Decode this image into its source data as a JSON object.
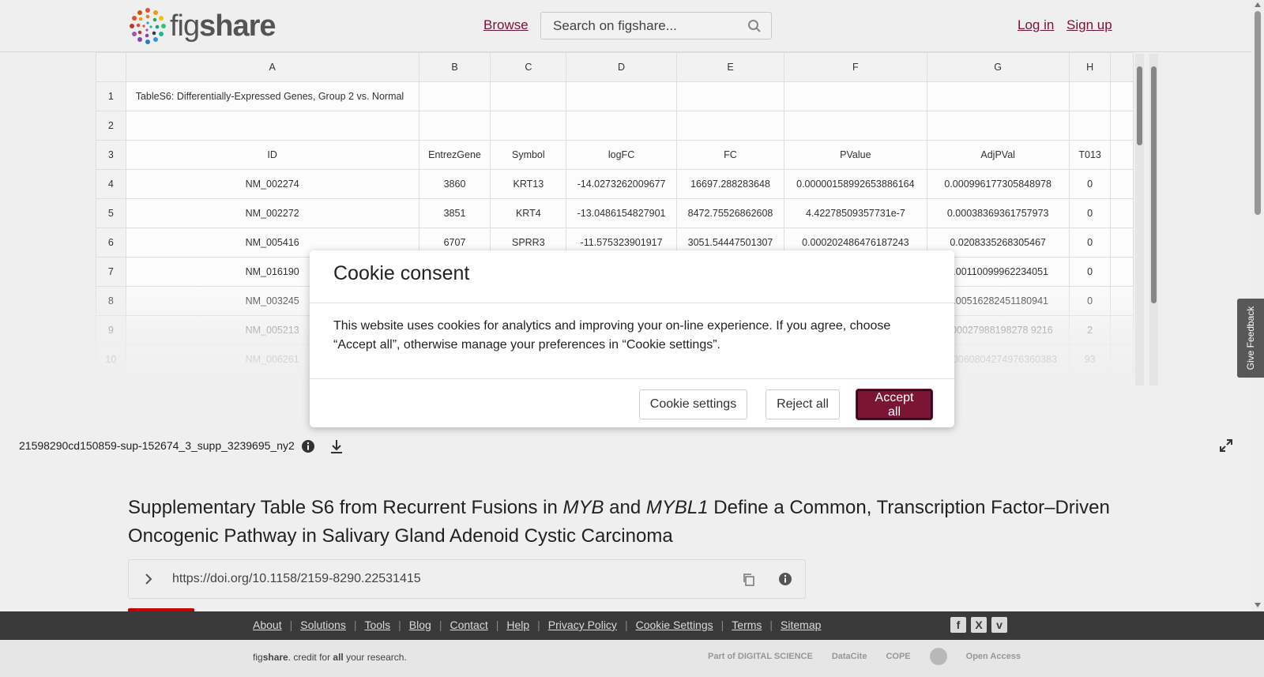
{
  "header": {
    "logo_text_light": "fig",
    "logo_text_bold": "share",
    "browse_label": "Browse",
    "search_placeholder": "Search on figshare...",
    "login_label": "Log in",
    "signup_label": "Sign up"
  },
  "sheet": {
    "columns": [
      "A",
      "B",
      "C",
      "D",
      "E",
      "F",
      "G",
      "H"
    ],
    "rows": [
      {
        "num": "1",
        "cells": [
          "TableS6: Differentially-Expressed Genes, Group 2 vs. Normal",
          "",
          "",
          "",
          "",
          "",
          "",
          ""
        ]
      },
      {
        "num": "2",
        "cells": [
          "",
          "",
          "",
          "",
          "",
          "",
          "",
          ""
        ]
      },
      {
        "num": "3",
        "cells": [
          "ID",
          "EntrezGene",
          "Symbol",
          "logFC",
          "FC",
          "PValue",
          "AdjPVal",
          "T013"
        ]
      },
      {
        "num": "4",
        "cells": [
          "NM_002274",
          "3860",
          "KRT13",
          "-14.0273262009677",
          "16697.288283648",
          "0.00000158992653886164",
          "0.000996177305848978",
          "0"
        ]
      },
      {
        "num": "5",
        "cells": [
          "NM_002272",
          "3851",
          "KRT4",
          "-13.0486154827901",
          "8472.75526862608",
          "4.42278509357731e-7",
          "0.00038369361757973",
          "0"
        ]
      },
      {
        "num": "6",
        "cells": [
          "NM_005416",
          "6707",
          "SPRR3",
          "-11.575323901917",
          "3051.54447501307",
          "0.000202486476187243",
          "0.0208335268305467",
          "0"
        ]
      },
      {
        "num": "7",
        "cells": [
          "NM_016190",
          "",
          "",
          "",
          "",
          "",
          "0.00110099962234051",
          "0"
        ]
      },
      {
        "num": "8",
        "cells": [
          "NM_003245",
          "",
          "",
          "",
          "",
          "",
          "0.00516282451180941",
          "0"
        ]
      },
      {
        "num": "9",
        "cells": [
          "NM_005213",
          "",
          "",
          "",
          "",
          "",
          "0.00027988198278 9216",
          "2"
        ]
      },
      {
        "num": "10",
        "cells": [
          "NM_006261",
          "",
          "",
          "",
          "",
          "",
          "0.00060804274976360383",
          "93"
        ]
      }
    ]
  },
  "file_bar": {
    "file_name": "21598290cd150859-sup-152674_3_supp_3239695_ny2"
  },
  "main": {
    "title_part1": "Supplementary Table S6 from Recurrent Fusions in ",
    "title_italic1": "MYB",
    "title_part2": " and ",
    "title_italic2": "MYBL1",
    "title_part3": " Define a Common, Transcription Factor–Driven Oncogenic Pathway in Salivary Gland Adenoid Cystic Carcinoma",
    "doi": "https://doi.org/10.1158/2159-8290.22531415"
  },
  "feedback_label": "Give Feedback",
  "footer": {
    "links": [
      "About",
      "Solutions",
      "Tools",
      "Blog",
      "Contact",
      "Help",
      "Privacy Policy",
      "Cookie Settings",
      "Terms",
      "Sitemap"
    ],
    "tagline_fig": "fig",
    "tagline_share": "share",
    "tagline_mid": ". credit for ",
    "tagline_all": "all",
    "tagline_end": " your research.",
    "partners": [
      "Part of DIGITAL SCIENCE",
      "DataCite",
      "COPE",
      "",
      "Open Access"
    ]
  },
  "cookie_modal": {
    "title": "Cookie consent",
    "body": "This website uses cookies for analytics and improving your on-line experience. If you agree, choose “Accept all”, otherwise manage your preferences in “Cookie settings”.",
    "settings_label": "Cookie settings",
    "reject_label": "Reject all",
    "accept_label": "Accept all"
  },
  "colors": {
    "brand": "#7a1535",
    "footer_dark": "#3a3a3a"
  }
}
